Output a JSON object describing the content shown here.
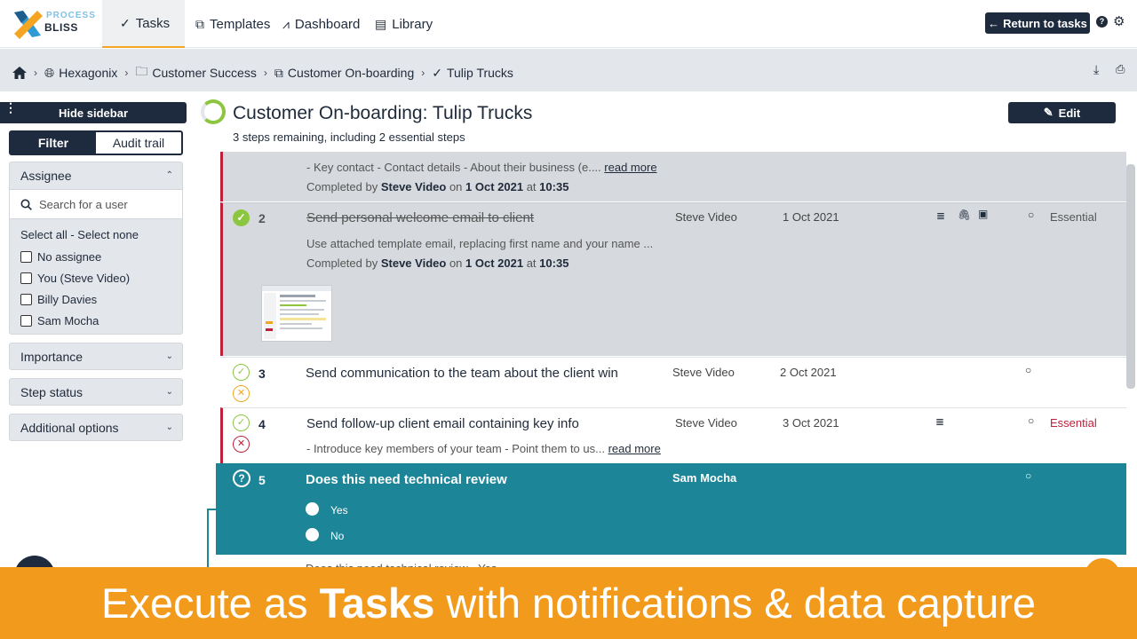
{
  "nav": {
    "logo_top": "PROCESS",
    "logo_bottom": "BLISS",
    "tabs": [
      {
        "label": "Tasks",
        "icon": "check-icon"
      },
      {
        "label": "Templates",
        "icon": "template-icon"
      },
      {
        "label": "Dashboard",
        "icon": "chart-icon"
      },
      {
        "label": "Library",
        "icon": "book-icon"
      }
    ],
    "return_label": "Return to tasks",
    "help": "?"
  },
  "breadcrumb": [
    {
      "label": "Hexagonix",
      "icon": "globe-icon"
    },
    {
      "label": "Customer Success",
      "icon": "folder-icon"
    },
    {
      "label": "Customer On-boarding",
      "icon": "template-icon"
    },
    {
      "label": "Tulip Trucks",
      "icon": "check-icon"
    }
  ],
  "sidebar": {
    "hide_label": "Hide sidebar",
    "filter_tab": "Filter",
    "audit_tab": "Audit trail",
    "assignee_header": "Assignee",
    "search_placeholder": "Search for a user",
    "select_line": "Select all - Select none",
    "assignees": [
      "No assignee",
      "You (Steve Video)",
      "Billy Davies",
      "Sam Mocha"
    ],
    "importance": "Importance",
    "step_status": "Step status",
    "additional": "Additional options"
  },
  "main": {
    "title_prefix": "Customer On-boarding:",
    "title_name": "Tulip Trucks",
    "subtitle": "3 steps remaining, including 2 essential steps",
    "edit_label": "Edit"
  },
  "step1": {
    "desc": "- Key contact - Contact details - About their business (e....",
    "read_more": "read more",
    "completed_by": "Completed by",
    "by": "Steve Video",
    "on": "on",
    "date": "1 Oct 2021",
    "at": "at",
    "time": "10:35"
  },
  "step2": {
    "num": "2",
    "title": "Send personal welcome email to client",
    "assignee": "Steve Video",
    "due": "1 Oct 2021",
    "essential": "Essential",
    "desc": "Use attached template email, replacing first name and your name ...",
    "completed_by": "Completed by",
    "by": "Steve Video",
    "on": "on",
    "date": "1 Oct 2021",
    "at": "at",
    "time": "10:35"
  },
  "step3": {
    "num": "3",
    "title": "Send communication to the team about the client win",
    "assignee": "Steve Video",
    "due": "2 Oct 2021"
  },
  "step4": {
    "num": "4",
    "title": "Send follow-up client email containing key info",
    "assignee": "Steve Video",
    "due": "3 Oct 2021",
    "essential": "Essential",
    "desc": "- Introduce key members of your team - Point them to us...",
    "read_more": "read more"
  },
  "step5": {
    "num": "5",
    "title": "Does this need technical review",
    "assignee": "Sam Mocha",
    "options": [
      "Yes",
      "No"
    ],
    "next_peek": "Does this need technical review - Yes"
  },
  "banner": {
    "pre": "Execute as",
    "bold": "Tasks",
    "post": "with notifications & data capture"
  },
  "colors": {
    "navy": "#1e2b3e",
    "teal": "#1c8597",
    "orange": "#f29a1b",
    "green": "#8cc63f",
    "red": "#c0203a"
  }
}
